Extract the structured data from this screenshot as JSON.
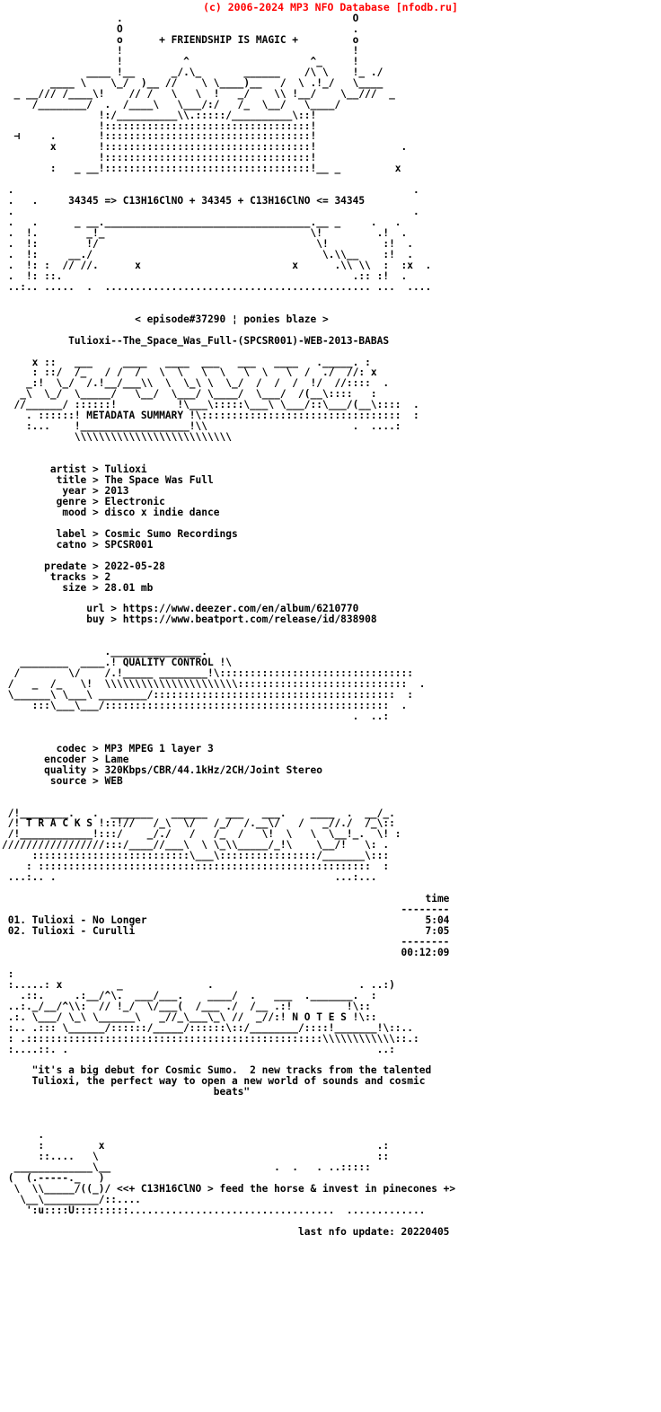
{
  "site": {
    "credit_line": "(c) 2006-2024 MP3 NFO Database [nfodb.ru]",
    "credit_color": "#ff0000"
  },
  "header": {
    "tagline": "+ FRIENDSHIP IS MAGIC +",
    "formula_line": "34345 => C13H16ClNO + 34345 + C13H16ClNO <= 34345",
    "episode_line": "< episode#37290 ¦ ponies blaze >",
    "release_name": "Tulioxi--The_Space_Was_Full-(SPCSR001)-WEB-2013-BABAS"
  },
  "sections": {
    "metadata_banner_label": "METADATA SUMMARY",
    "quality_banner_label": "QUALITY CONTROL",
    "tracks_banner_label": "T R A C K S",
    "notes_banner_label": "N O T E S"
  },
  "metadata": {
    "groups": [
      [
        {
          "key": "artist",
          "value": "Tulioxi"
        },
        {
          "key": "title",
          "value": "The Space Was Full"
        },
        {
          "key": "year",
          "value": "2013"
        },
        {
          "key": "genre",
          "value": "Electronic"
        },
        {
          "key": "mood",
          "value": "disco x indie dance"
        }
      ],
      [
        {
          "key": "label",
          "value": "Cosmic Sumo Recordings"
        },
        {
          "key": "catno",
          "value": "SPCSR001"
        }
      ],
      [
        {
          "key": "predate",
          "value": "2022-05-28"
        },
        {
          "key": "tracks",
          "value": "2"
        },
        {
          "key": "size",
          "value": "28.01 mb"
        }
      ],
      [
        {
          "key": "url",
          "value": "https://www.deezer.com/en/album/6210770"
        },
        {
          "key": "buy",
          "value": "https://www.beatport.com/release/id/838908"
        }
      ]
    ]
  },
  "quality": {
    "fields": [
      {
        "key": "codec",
        "value": "MP3 MPEG 1 layer 3"
      },
      {
        "key": "encoder",
        "value": "Lame"
      },
      {
        "key": "quality",
        "value": "320Kbps/CBR/44.1kHz/2CH/Joint Stereo"
      },
      {
        "key": "source",
        "value": "WEB"
      }
    ]
  },
  "tracklist": {
    "time_header": "time",
    "rule": "--------",
    "tracks": [
      {
        "num": "01.",
        "artist": "Tulioxi",
        "title": "No Longer",
        "time": "5:04"
      },
      {
        "num": "02.",
        "artist": "Tulioxi",
        "title": "Curulli",
        "time": "7:05"
      }
    ],
    "total_time": "00:12:09"
  },
  "notes": {
    "lines": [
      "\"it's a big debut for Cosmic Sumo.  2 new tracks from the talented",
      "Tulioxi, the perfect way to open a new world of sounds and cosmic",
      "beats\""
    ]
  },
  "footer": {
    "slogan": "<<+ C13H16ClNO > feed the horse & invest in pinecones +>",
    "last_update_label": "last nfo update:",
    "last_update_value": "20220405"
  },
  "ascii": {
    "header_art": "                  .                                       O\n                  O                                       .\n                  o       + FRIENDSHIP IS MAGIC +         o\n                  !                                       !\n                  !           ^                   ^_      !  .\n        ____      !__       _/.\\_      ______     /\\ \\     !_/\n  _ __\\\\    \\_/    )__//   \\ \\____)__ /  \\.!_/  \\____\n _  __///  /____\\!    //  /  \\   \\ !    _/   \\\\ !__/   \\__///  _\n      /________/  .  /____\\  \\___/:/   /_ \\__/   \\____/\n                 !:/__________\\\\.:::::/__________\\::!\n                 !::::::::::::::::::::::::::::::::::!\n ⊣      .        !::::::::::::::::::::::::::::::::::!\n        x        !::::::::::::::::::::::::::::::::::!        .\n                 !::::::::::::::::::::::::::::::::::!\n        :    _ __!::::::::::::::::::::::::::::::::::!__ _     x",
    "mid_art_top": " .    .      34345 => C13H16ClNO + 34345 + C13H16ClNO <= 34345       .\n .                                                                  .\n .    .      _ __.________________________________.__ _     .  .  .\n .  !.        _!_                                  \\!          .!  .\n .  !:        !/                                    \\!          :!  .\n .  !:     __./                                      .\\___\\\\     :!  .\n .  !:  : // //.        x                       x      .\\\\  \\\\   :  :x  .\n .  !: ::.                                                  .:: :!  .\n ..:.. .....  .  ..........................................  ...  ....",
    "metadata_banner": "      x ::   ___      ___    ____  ___   ____   ____      ._____. :\n      : ::/   /_   /  /  /   \\ \\  \\   \\  \\   \\  \\    /   ./  //: x\n      _:!  \\_/  /.!__/___\\\\ \\  \\_\\  \\  \\__/  /  /  /   !/  //::::  .\n     _\\  \\_/  \\_____/   \\__/  \\___/  \\____/  \\___/   /(__\\::::   :\n    //______/ :::::!             !\\___\\:::::\\___\\ \\___/::\\___/(__\\::::  .\n      . ::::::! METADATA SUMMARY !\\:::::::::::::::::::::::::::::::::  :\n      :... !__________________!\\\\                         .  ....:\n           \\\\\\\\\\\\\\\\\\\\\\\\\\\\\\\\\\\\\\\\\\\\\\\\\\\\\\",
    "quality_banner": "                   ._______________.\n  ________  ____ .! QUALITY CONTROL !\\\n /        \\/    /.!_____ ________!\\::::::::::::::::::::::::::::::::\n/   _  /_   \\!   \\\\\\\\\\\\\\\\\\\\\\\\\\\\\\\\\\\\\\\\\\\\\\\\\\\\::::::::::::::::::::::::::::::  .\n\\______\\ \\___\\ ________/::::::::::::::::::::::::::::::::::::::::::  :\n   :::\\___\\___/::::::::::::::::::::::::::::::::::::::::::::::::::::  .\n                                                           . ..:",
    "tracks_banner": " /!________.   .  _______  ______  ___   ___.   ____  .  __/_.\n /! T R A C K S !::!//    /_\\  \\/   /_/ /.__\\/  /   _//./  /_\\::\n /!_____________!:::/     _/./   /  /_  /  \\!  \\  \\  \\__!_.  \\! :\n/////////////////:::/____//___\\  \\ \\_\\\\_____/_!\\   \\__/!   \\: .\n     :::::::::::::::::::::::::\\___\\::::::::::::::::/_______\\:::\n    : ::::::::::::::::::::::::::::::::::::::::::::::::::::::::  :\n ...:.. .                                               ...:...",
    "notes_banner": " :.....:  x         _              .                        . ..:)\n   .::.      .:__/^\\.  ___/___.    ____/ .   ___   ._______.. :\n ..:._/___/^\\\\: // !_/ \\/___(  /____ ./  /__ .:!         !\\::\n .:. \\___/ \\_\\ \\______\\   _//_\\___\\_\\  //  _//:!  N O T E S !\\::\n :.. .::: \\______/:::::::/____/::::::\\::/_________/::::!_______!\\::..\n : .::::::::::::::::::::::::::::::::::::::::::::::::::\\\\\\\\\\\\\\\\\\\\\\\\::.:\n :....::. .                                                    ..:",
    "footer_art": "      .\n      :        x                                              .:\n      ::....  \\                                               ::\n  _______________\\__                             .  .   . ..:::::\n (  (.-----._   )\n  \\  \\\\_____/((_)/ ",
    "footer_art_tail": "  \\__\\_________/::....\n    ':u::::U:::::::::...................................  ............."
  }
}
